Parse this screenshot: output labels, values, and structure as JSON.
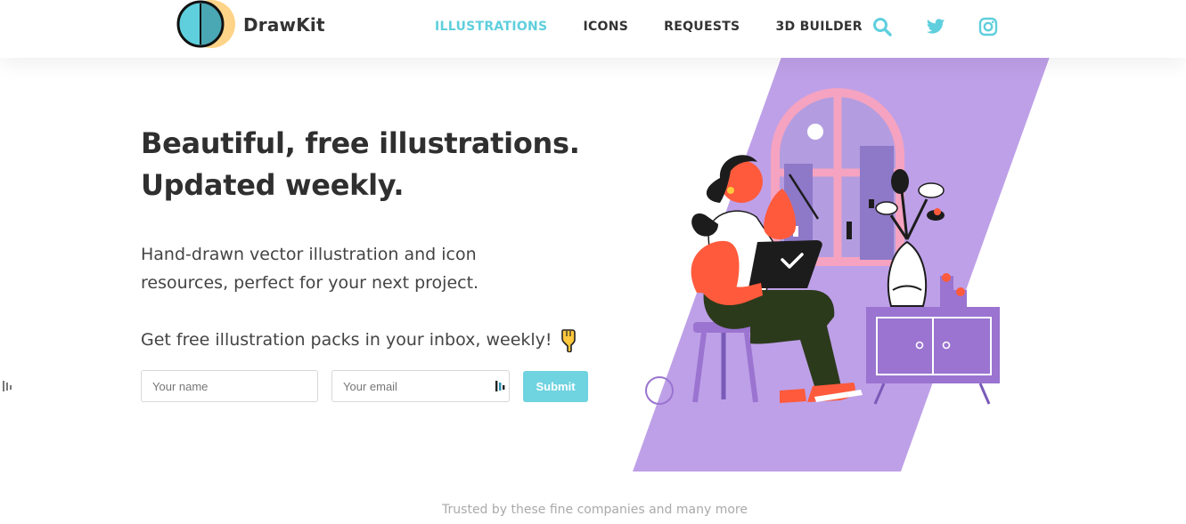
{
  "brand": {
    "name": "DrawKit",
    "accent_color": "#5fcfdd",
    "logo_colors": [
      "#5fcfdd",
      "#ffd488",
      "#111111"
    ]
  },
  "nav": {
    "items": [
      {
        "label": "ILLUSTRATIONS",
        "active": true
      },
      {
        "label": "ICONS",
        "active": false
      },
      {
        "label": "REQUESTS",
        "active": false
      },
      {
        "label": "3D BUILDER",
        "active": false
      }
    ],
    "icons": [
      "search-icon",
      "twitter-icon",
      "instagram-icon"
    ]
  },
  "hero": {
    "headline_line1": "Beautiful, free illustrations.",
    "headline_line2": "Updated weekly.",
    "subhead_line1": "Hand-drawn vector illustration and icon",
    "subhead_line2": "resources, perfect for your next project.",
    "promo": "Get free illustration packs in your inbox, weekly!",
    "promo_icon": "pointing-down-hand-icon"
  },
  "signup": {
    "name_placeholder": "Your name",
    "email_placeholder": "Your email",
    "submit_label": "Submit",
    "submit_color": "#6fd3e0"
  },
  "illustration": {
    "icon": "woman-with-laptop-illustration",
    "panel_color": "#bea0e8"
  },
  "footer": {
    "trusted_text": "Trusted by these fine companies and many more"
  }
}
